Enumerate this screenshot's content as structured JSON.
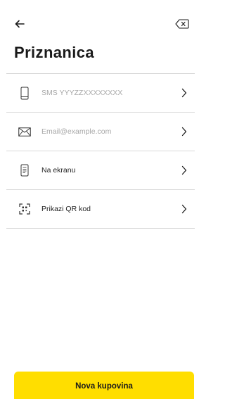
{
  "header": {
    "back_icon": "arrow-left-icon",
    "clear_icon": "backspace-icon",
    "title": "Priznanica"
  },
  "options": [
    {
      "id": "sms",
      "icon": "phone-icon",
      "text": "SMS YYYZZXXXXXXXX",
      "is_placeholder": true
    },
    {
      "id": "email",
      "icon": "envelope-icon",
      "text": "Email@example.com",
      "is_placeholder": true
    },
    {
      "id": "screen",
      "icon": "receipt-screen-icon",
      "text": "Na ekranu",
      "is_placeholder": false
    },
    {
      "id": "qr",
      "icon": "qr-scan-icon",
      "text": "Prikazi QR kod",
      "is_placeholder": false
    }
  ],
  "chevron_icon": "chevron-right-icon",
  "footer": {
    "primary_button_label": "Nova kupovina"
  },
  "colors": {
    "accent": "#ffde00",
    "text": "#1a1a1a",
    "placeholder": "#a7a7a7",
    "divider": "#d9d9d9"
  }
}
